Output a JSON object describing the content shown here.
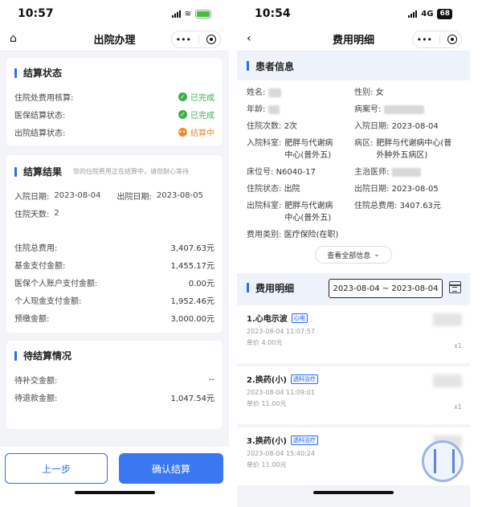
{
  "left": {
    "status_time": "10:57",
    "title": "出院办理",
    "status_section": {
      "title": "结算状态",
      "rows": [
        {
          "label": "住院处费用核算:",
          "status": "已完成",
          "state": "ok"
        },
        {
          "label": "医保结算状态:",
          "status": "已完成",
          "state": "ok"
        },
        {
          "label": "出院结算状态:",
          "status": "结算中",
          "state": "pending"
        }
      ]
    },
    "result_section": {
      "title": "结算结果",
      "note": "您的住院费用正在结算中，请您耐心等待",
      "admit_label": "入院日期:",
      "admit_date": "2023-08-04",
      "discharge_label": "出院日期:",
      "discharge_date": "2023-08-05",
      "days_label": "住院天数:",
      "days": "2",
      "amounts": [
        {
          "label": "住院总费用:",
          "value": "3,407.63元"
        },
        {
          "label": "基金支付金额:",
          "value": "1,455.17元"
        },
        {
          "label": "医保个人账户支付金额:",
          "value": "0.00元"
        },
        {
          "label": "个人现金支付金额:",
          "value": "1,952.46元"
        },
        {
          "label": "预缴金额:",
          "value": "3,000.00元"
        }
      ]
    },
    "pending_section": {
      "title": "待结算情况",
      "rows": [
        {
          "label": "待补交金额:",
          "value": "--"
        },
        {
          "label": "待退款金额:",
          "value": "1,047.54元"
        }
      ]
    },
    "btn_prev": "上一步",
    "btn_confirm": "确认结算"
  },
  "right": {
    "status_time": "10:54",
    "network": "4G",
    "battery": "68",
    "title": "费用明细",
    "patient_section": "患者信息",
    "fields": {
      "name_label": "姓名:",
      "gender_label": "性别:",
      "gender": "女",
      "age_label": "年龄:",
      "record_label": "病案号:",
      "times_label": "住院次数:",
      "times": "2次",
      "admit_label": "入院日期:",
      "admit_date": "2023-08-04",
      "dept_label": "入院科室:",
      "dept": "肥胖与代谢病中心(普外五)",
      "ward_label": "病区:",
      "ward": "肥胖与代谢病中心(普外肿外五病区)",
      "bed_label": "床位号:",
      "bed": "N6040-17",
      "doctor_label": "主治医师:",
      "state_label": "住院状态:",
      "state": "出院",
      "discharge_label": "出院日期:",
      "discharge_date": "2023-08-05",
      "out_dept_label": "出院科室:",
      "out_dept": "肥胖与代谢病中心(普外五)",
      "total_label": "住院总费用:",
      "total": "3407.63元",
      "fee_type_label": "费用类别:",
      "fee_type": "医疗保险(在职)"
    },
    "view_all": "查看全部信息",
    "fee_section": "费用明细",
    "date_range": "2023-08-04 ~ 2023-08-04",
    "items": [
      {
        "name": "1.心电示波",
        "tag": "心电",
        "time": "2023-08-04 11:07:57",
        "price": "单价 4.00元",
        "qty": "x1"
      },
      {
        "name": "2.换药(小)",
        "tag": "透科治疗",
        "time": "2023-08-04 11:09:01",
        "price": "单价 11.00元",
        "qty": "x1"
      },
      {
        "name": "3.换药(小)",
        "tag": "透科治疗",
        "time": "2023-08-04 15:40:24",
        "price": "单价 11.00元",
        "qty": ""
      }
    ]
  }
}
